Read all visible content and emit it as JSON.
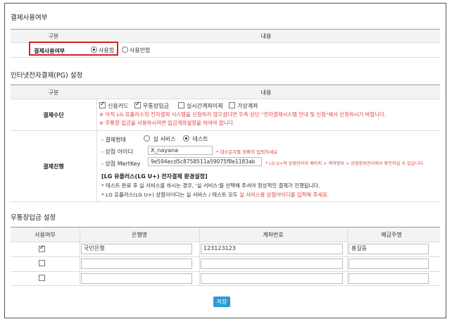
{
  "section1": {
    "title": "결제사용여부",
    "col_header_1": "구분",
    "col_header_2": "내용",
    "row_label": "결제사용여부",
    "opt_use": "사용함",
    "opt_nouse": "사용안함",
    "selected": "사용함"
  },
  "section2": {
    "title": "인터넷전자결제(PG) 설정",
    "col_header_1": "구분",
    "col_header_2": "내용",
    "method_label": "결제수단",
    "methods": [
      {
        "label": "신용카드",
        "checked": true
      },
      {
        "label": "무통장입금",
        "checked": true
      },
      {
        "label": "실시간계좌이체",
        "checked": false
      },
      {
        "label": "가상계좌",
        "checked": false
      }
    ],
    "notice1": "※ 아직 LG 유플러스의 전자결제 시스템을 신청하지 않으셨다면 우측 상단 \"전자결제시스템 안내 및 신청\"에서 신청하시기 바랍니다.",
    "notice2": "※ 무통장 입금을 사용하시려면 입금계좌설정을 하여야 합니다.",
    "progress_label": "결제진행",
    "mode_label": "- 결제형태",
    "mode_live": "실 서비스",
    "mode_test": "테스트",
    "mode_selected": "테스트",
    "store_id_label": "- 상점 아이디",
    "store_id_value": "X_nayana",
    "store_id_hint": "* 대소문자를 정확히 입력하세요",
    "mertkey_label": "- 상점 MertKey",
    "mertkey_value": "9e594ecd5c8758511a59075f8e1183ab",
    "mertkey_hint": "* LG U+의 상점관리자 페이지 > 계약정보 > 상점정보관리에서 확인하실 수 있습니다.",
    "env_title": "[LG 유플러스(LG U+) 전자결제 환경설정]",
    "env_line1": "* 테스트 완료 후 실 서비스를 하시는 경우, '실 서비스'를 선택해 주셔야 정상적인 결제가 진행됩니다.",
    "env_line2_a": "* LG 유플러스(LG U+) 상점아이디는 실 서비스 / 테스트 모두 ",
    "env_line2_b": "실 서비스용 상점아이디를 입력해 주세요."
  },
  "section3": {
    "title": "무통장입금 설정",
    "headers": [
      "사용여부",
      "은행명",
      "계좌번호",
      "예금주명"
    ],
    "rows": [
      {
        "use": true,
        "bank": "국민은행",
        "account": "123123123",
        "holder": "홍길동"
      },
      {
        "use": false,
        "bank": "",
        "account": "",
        "holder": ""
      },
      {
        "use": false,
        "bank": "",
        "account": "",
        "holder": ""
      }
    ]
  },
  "save_label": "저장",
  "colors": {
    "accent": "#2e9ad8",
    "warning": "#e04040",
    "highlight_box": "#d62020"
  }
}
